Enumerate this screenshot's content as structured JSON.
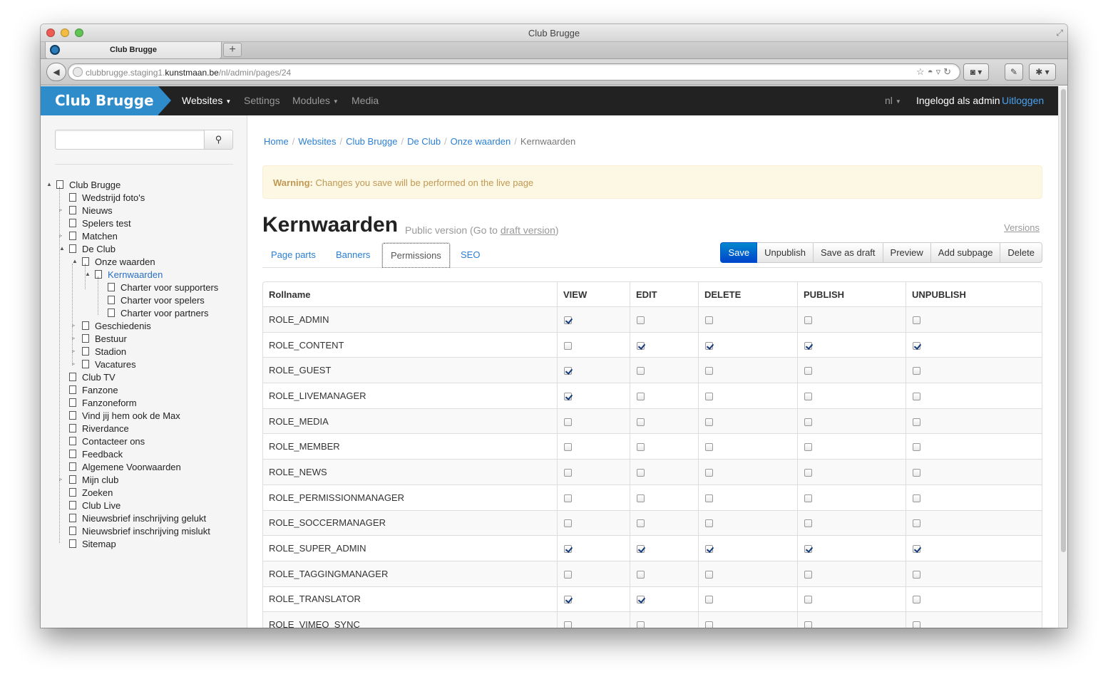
{
  "window": {
    "title": "Club Brugge"
  },
  "browser": {
    "tab_label": "Club Brugge",
    "newtab_label": "+",
    "url_prefix": "clubbrugge.staging1.",
    "url_domain": "kunstmaan.be",
    "url_path": "/nl/admin/pages/24"
  },
  "appbar": {
    "brand": "Club Brugge",
    "nav": [
      "Websites",
      "Settings",
      "Modules",
      "Media"
    ],
    "lang": "nl",
    "logged_in": "Ingelogd als admin",
    "logout": "Uitloggen"
  },
  "sidebar": {
    "tree": [
      {
        "label": "Club Brugge",
        "level": 0,
        "toggle": true
      },
      {
        "label": "Wedstrijd foto's",
        "level": 1
      },
      {
        "label": "Nieuws",
        "level": 1,
        "toggle": true,
        "collapsed": true
      },
      {
        "label": "Spelers test",
        "level": 1
      },
      {
        "label": "Matchen",
        "level": 1,
        "toggle": true,
        "collapsed": true
      },
      {
        "label": "De Club",
        "level": 1,
        "toggle": true
      },
      {
        "label": "Onze waarden",
        "level": 2,
        "toggle": true
      },
      {
        "label": "Kernwaarden",
        "level": 3,
        "toggle": true,
        "current": true
      },
      {
        "label": "Charter voor supporters",
        "level": 4
      },
      {
        "label": "Charter voor spelers",
        "level": 4
      },
      {
        "label": "Charter voor partners",
        "level": 4
      },
      {
        "label": "Geschiedenis",
        "level": 2,
        "toggle": true,
        "collapsed": true
      },
      {
        "label": "Bestuur",
        "level": 2,
        "toggle": true,
        "collapsed": true
      },
      {
        "label": "Stadion",
        "level": 2,
        "toggle": true,
        "collapsed": true
      },
      {
        "label": "Vacatures",
        "level": 2,
        "toggle": true,
        "collapsed": true
      },
      {
        "label": "Club TV",
        "level": 1
      },
      {
        "label": "Fanzone",
        "level": 1
      },
      {
        "label": "Fanzoneform",
        "level": 1
      },
      {
        "label": "Vind jij hem ook de Max",
        "level": 1
      },
      {
        "label": "Riverdance",
        "level": 1
      },
      {
        "label": "Contacteer ons",
        "level": 1
      },
      {
        "label": "Feedback",
        "level": 1
      },
      {
        "label": "Algemene Voorwaarden",
        "level": 1
      },
      {
        "label": "Mijn club",
        "level": 1,
        "toggle": true,
        "collapsed": true
      },
      {
        "label": "Zoeken",
        "level": 1
      },
      {
        "label": "Club Live",
        "level": 1
      },
      {
        "label": "Nieuwsbrief inschrijving gelukt",
        "level": 1
      },
      {
        "label": "Nieuwsbrief inschrijving mislukt",
        "level": 1
      },
      {
        "label": "Sitemap",
        "level": 1
      }
    ]
  },
  "breadcrumb": [
    "Home",
    "Websites",
    "Club Brugge",
    "De Club",
    "Onze waarden",
    "Kernwaarden"
  ],
  "alert": {
    "strong": "Warning:",
    "text": "Changes you save will be performed on the live page"
  },
  "page": {
    "title": "Kernwaarden",
    "subtitle_pre": "Public version (Go to ",
    "subtitle_link": "draft version",
    "subtitle_post": ")",
    "versions_link": "Versions"
  },
  "tabs": [
    "Page parts",
    "Banners",
    "Permissions",
    "SEO"
  ],
  "active_tab": "Permissions",
  "actions": [
    "Save",
    "Unpublish",
    "Save as draft",
    "Preview",
    "Add subpage",
    "Delete"
  ],
  "permissions": {
    "headers": [
      "Rollname",
      "VIEW",
      "EDIT",
      "DELETE",
      "PUBLISH",
      "UNPUBLISH"
    ],
    "rows": [
      {
        "role": "ROLE_ADMIN",
        "flags": [
          true,
          false,
          false,
          false,
          false
        ]
      },
      {
        "role": "ROLE_CONTENT",
        "flags": [
          false,
          true,
          true,
          true,
          true
        ]
      },
      {
        "role": "ROLE_GUEST",
        "flags": [
          true,
          false,
          false,
          false,
          false
        ]
      },
      {
        "role": "ROLE_LIVEMANAGER",
        "flags": [
          true,
          false,
          false,
          false,
          false
        ]
      },
      {
        "role": "ROLE_MEDIA",
        "flags": [
          false,
          false,
          false,
          false,
          false
        ]
      },
      {
        "role": "ROLE_MEMBER",
        "flags": [
          false,
          false,
          false,
          false,
          false
        ]
      },
      {
        "role": "ROLE_NEWS",
        "flags": [
          false,
          false,
          false,
          false,
          false
        ]
      },
      {
        "role": "ROLE_PERMISSIONMANAGER",
        "flags": [
          false,
          false,
          false,
          false,
          false
        ]
      },
      {
        "role": "ROLE_SOCCERMANAGER",
        "flags": [
          false,
          false,
          false,
          false,
          false
        ]
      },
      {
        "role": "ROLE_SUPER_ADMIN",
        "flags": [
          true,
          true,
          true,
          true,
          true
        ]
      },
      {
        "role": "ROLE_TAGGINGMANAGER",
        "flags": [
          false,
          false,
          false,
          false,
          false
        ]
      },
      {
        "role": "ROLE_TRANSLATOR",
        "flags": [
          true,
          true,
          false,
          false,
          false
        ]
      },
      {
        "role": "ROLE_VIMEO_SYNC",
        "flags": [
          false,
          false,
          false,
          false,
          false
        ]
      }
    ]
  },
  "colors": {
    "brand": "#2f8ccb",
    "link": "#2a7fd4",
    "primary_button": "#0066cc",
    "alert_bg": "#fcf8e3"
  }
}
